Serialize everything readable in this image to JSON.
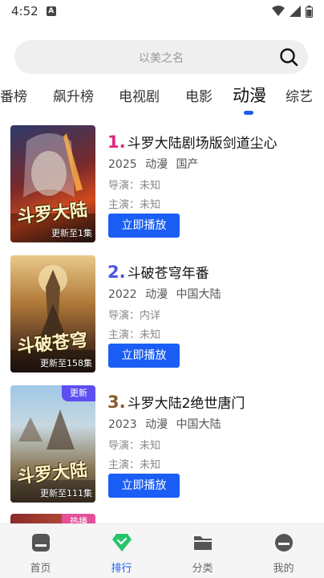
{
  "status_bar": {
    "time": "4:52",
    "notification_letter": "A"
  },
  "search": {
    "placeholder": "以美之名"
  },
  "tabs": [
    {
      "label": "番榜"
    },
    {
      "label": "飙升榜"
    },
    {
      "label": "电视剧"
    },
    {
      "label": "电影"
    },
    {
      "label": "动漫",
      "active": true
    },
    {
      "label": "综艺"
    }
  ],
  "items": [
    {
      "rank": "1.",
      "rank_color": "#e0287d",
      "title": "斗罗大陆剧场版剑道尘心",
      "year": "2025",
      "category": "动漫",
      "region": "国产",
      "director": "导演：未知",
      "cast": "主演：未知",
      "update": "更新至1集",
      "poster_text": "斗罗大陆",
      "badge": "",
      "button": "立即播放"
    },
    {
      "rank": "2.",
      "rank_color": "#4a56e2",
      "title": "斗破苍穹年番",
      "year": "2022",
      "category": "动漫",
      "region": "中国大陆",
      "director": "导演：内详",
      "cast": "主演：未知",
      "update": "更新至158集",
      "poster_text": "斗破苍穹",
      "badge": "",
      "button": "立即播放"
    },
    {
      "rank": "3.",
      "rank_color": "#8a5a2b",
      "title": "斗罗大陆2绝世唐门",
      "year": "2023",
      "category": "动漫",
      "region": "中国大陆",
      "director": "导演：未知",
      "cast": "主演：未知",
      "update": "更新至111集",
      "poster_text": "斗罗大陆",
      "badge": "更新",
      "button": "立即播放"
    }
  ],
  "peek_badge": "热播",
  "bottom_nav": [
    {
      "label": "首页",
      "icon": "home-icon"
    },
    {
      "label": "排行",
      "icon": "ranking-icon",
      "active": true
    },
    {
      "label": "分类",
      "icon": "folder-icon"
    },
    {
      "label": "我的",
      "icon": "profile-icon"
    }
  ],
  "colors": {
    "accent": "#1a5ef5",
    "badge_new": "#5c4ef0",
    "badge_hot": "#e44f9a",
    "nav_active_icon": "#27c46b"
  }
}
